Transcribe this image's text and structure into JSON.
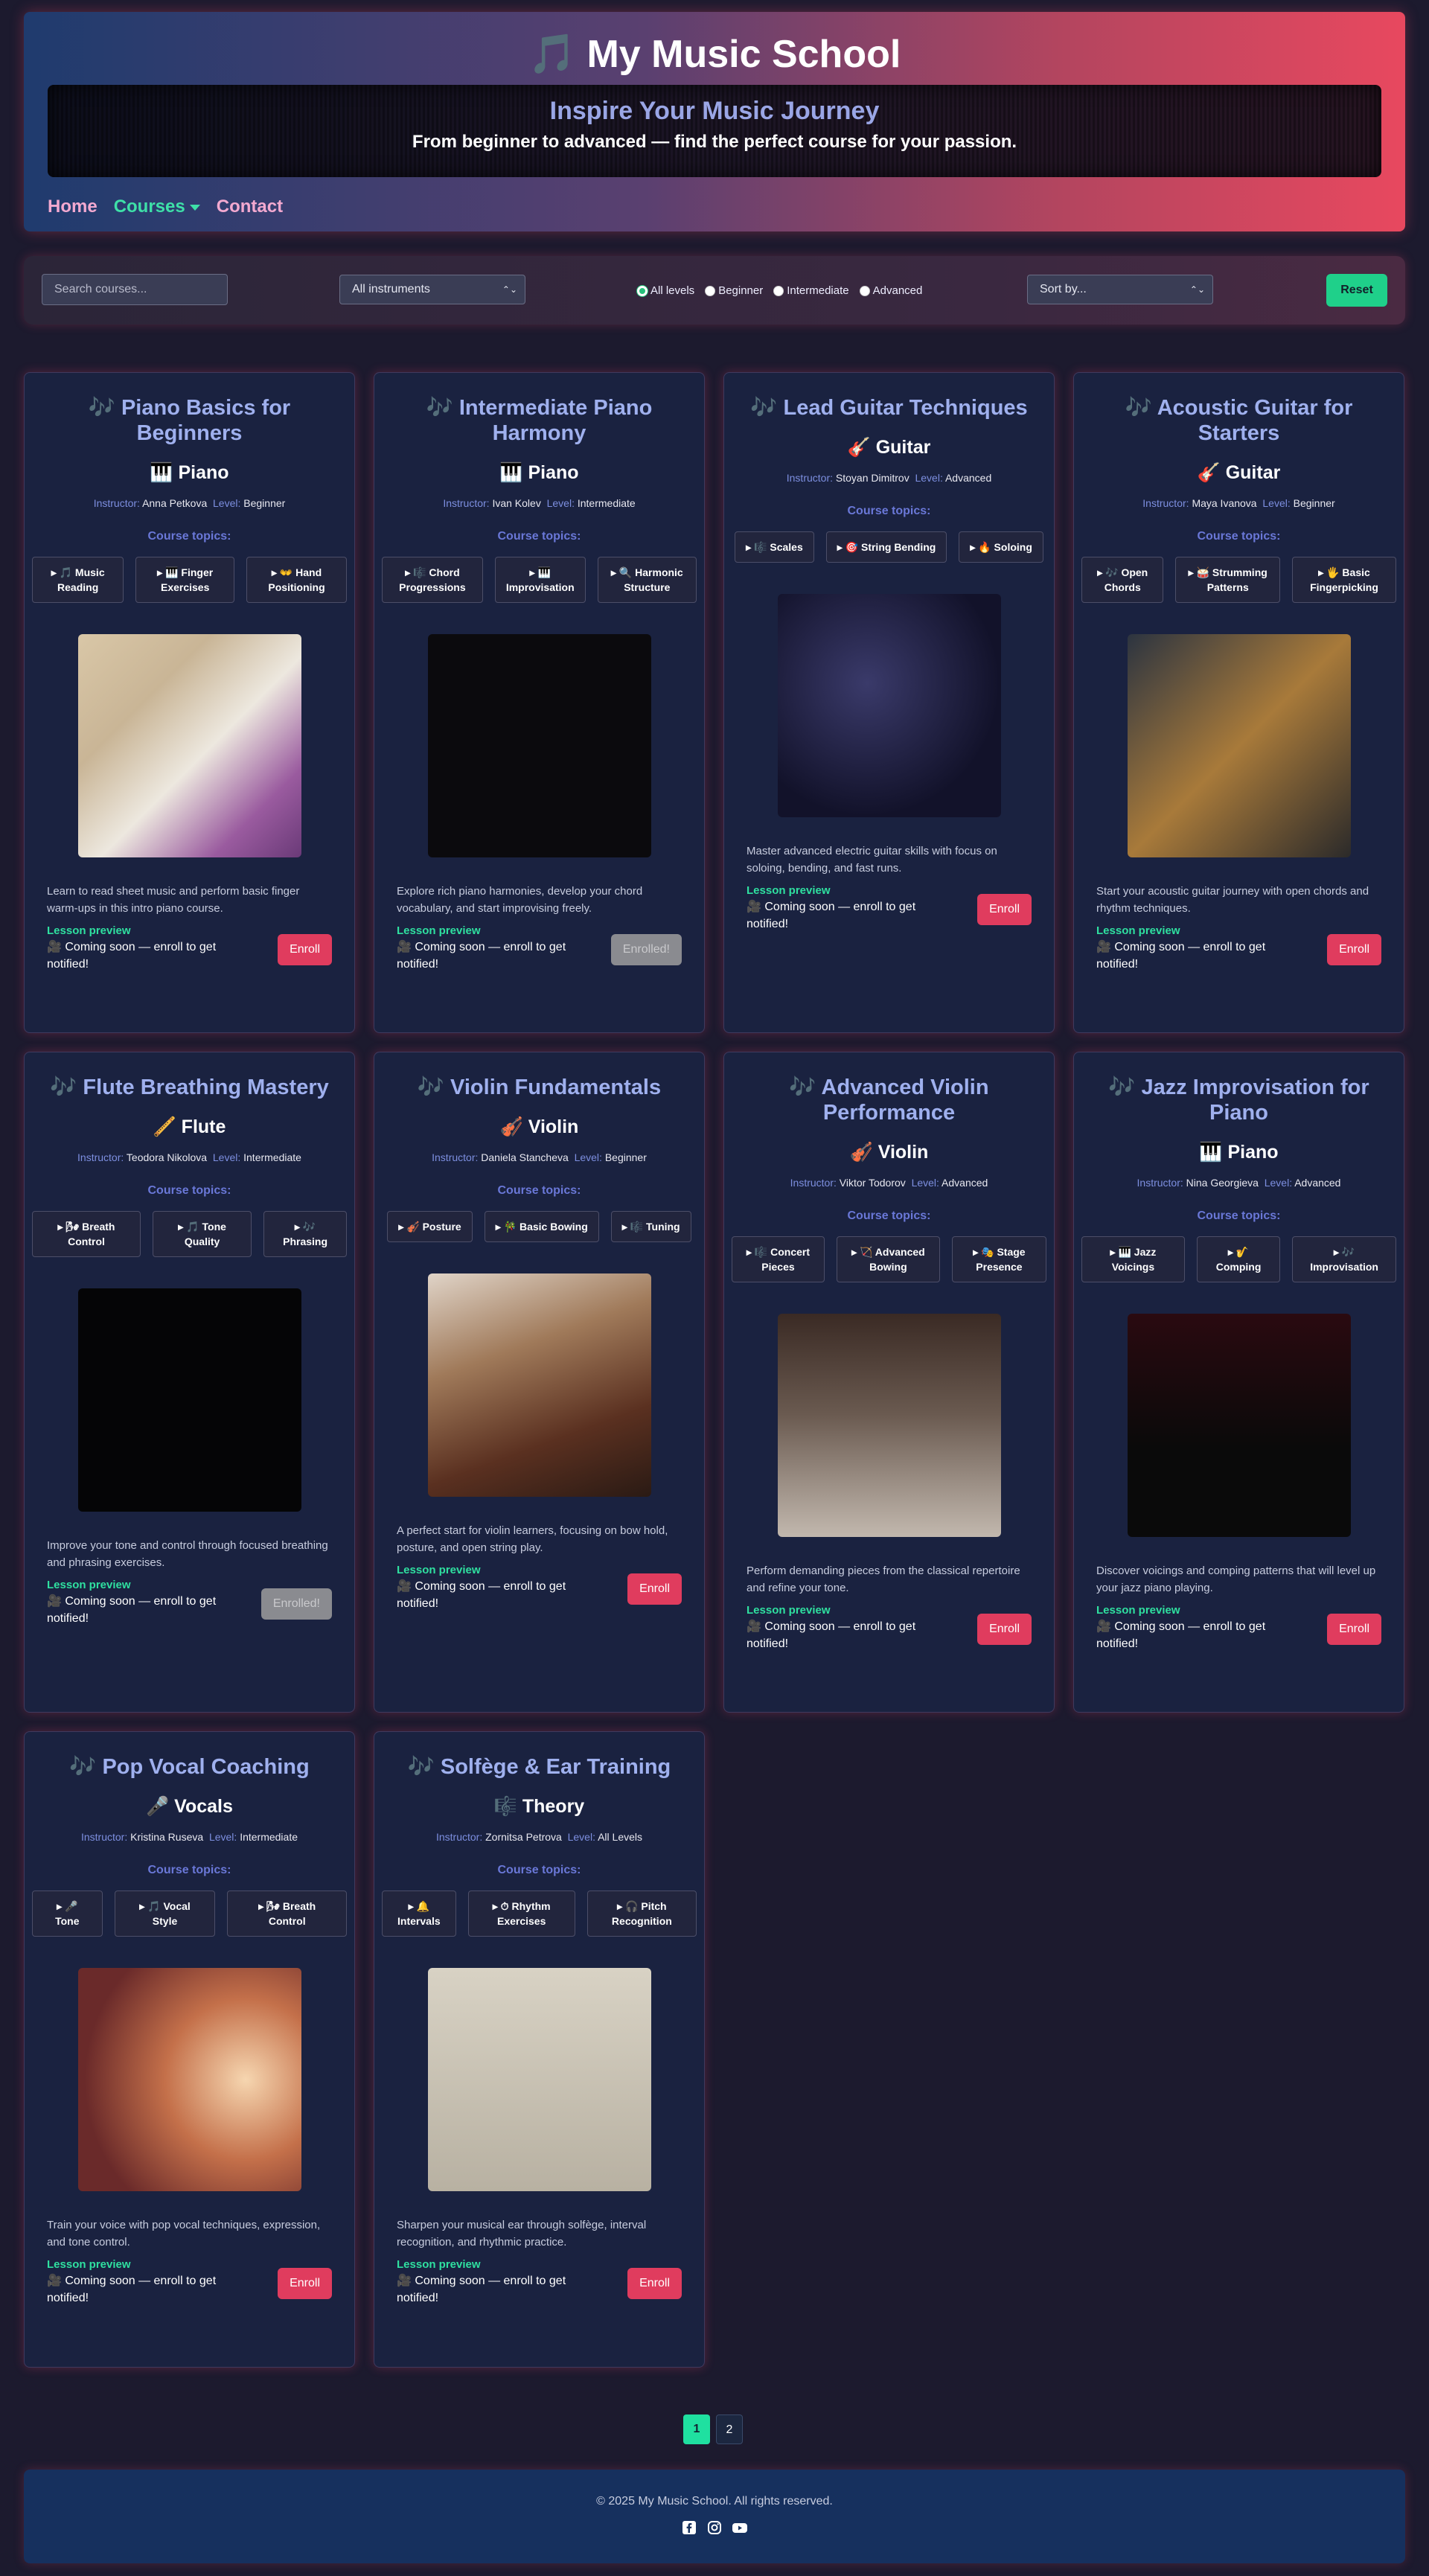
{
  "header": {
    "title": "My Music School",
    "title_icon": "music-note-icon",
    "hero_title": "Inspire Your Music Journey",
    "hero_subtitle": "From beginner to advanced — find the perfect course for your passion."
  },
  "nav": {
    "items": [
      {
        "label": "Home"
      },
      {
        "label": "Courses"
      },
      {
        "label": "Contact"
      }
    ]
  },
  "filters": {
    "search_placeholder": "Search courses...",
    "instrument_select": "All instruments",
    "levels": [
      "All levels",
      "Beginner",
      "Intermediate",
      "Advanced"
    ],
    "sort_select": "Sort by...",
    "reset_label": "Reset"
  },
  "labels": {
    "instructor": "Instructor:",
    "level": "Level:",
    "topics": "Course topics:",
    "preview": "Lesson preview",
    "coming_soon": "🎥 Coming soon — enroll to get notified!"
  },
  "courses": [
    {
      "title": "🎶 Piano Basics for Beginners",
      "instrument": "🎹 Piano",
      "instructor": "Anna Petkova",
      "level": "Beginner",
      "topics": [
        "▸ 🎵 Music Reading",
        "▸ 🎹 Finger Exercises",
        "▸ 👐 Hand Positioning"
      ],
      "description": "Learn to read sheet music and perform basic finger warm-ups in this intro piano course.",
      "button": "Enroll",
      "enrolled": false
    },
    {
      "title": "🎶 Intermediate Piano Harmony",
      "instrument": "🎹 Piano",
      "instructor": "Ivan Kolev",
      "level": "Intermediate",
      "topics": [
        "▸ 🎼 Chord Progressions",
        "▸ 🎹 Improvisation",
        "▸ 🔍 Harmonic Structure"
      ],
      "description": "Explore rich piano harmonies, develop your chord vocabulary, and start improvising freely.",
      "button": "Enrolled!",
      "enrolled": true
    },
    {
      "title": "🎶 Lead Guitar Techniques",
      "instrument": "🎸 Guitar",
      "instructor": "Stoyan Dimitrov",
      "level": "Advanced",
      "topics": [
        "▸ 🎼 Scales",
        "▸ 🎯 String Bending",
        "▸ 🔥 Soloing"
      ],
      "description": "Master advanced electric guitar skills with focus on soloing, bending, and fast runs.",
      "button": "Enroll",
      "enrolled": false
    },
    {
      "title": "🎶 Acoustic Guitar for Starters",
      "instrument": "🎸 Guitar",
      "instructor": "Maya Ivanova",
      "level": "Beginner",
      "topics": [
        "▸ 🎶 Open Chords",
        "▸ 🥁 Strumming Patterns",
        "▸ 🖐 Basic Fingerpicking"
      ],
      "description": "Start your acoustic guitar journey with open chords and rhythm techniques.",
      "button": "Enroll",
      "enrolled": false
    },
    {
      "title": "🎶 Flute Breathing Mastery",
      "instrument": "🪈 Flute",
      "instructor": "Teodora Nikolova",
      "level": "Intermediate",
      "topics": [
        "▸ 🌬 Breath Control",
        "▸ 🎵 Tone Quality",
        "▸ 🎶 Phrasing"
      ],
      "description": "Improve your tone and control through focused breathing and phrasing exercises.",
      "button": "Enrolled!",
      "enrolled": true
    },
    {
      "title": "🎶 Violin Fundamentals",
      "instrument": "🎻 Violin",
      "instructor": "Daniela Stancheva",
      "level": "Beginner",
      "topics": [
        "▸ 🎻 Posture",
        "▸ 🎋 Basic Bowing",
        "▸ 🎼 Tuning"
      ],
      "description": "A perfect start for violin learners, focusing on bow hold, posture, and open string play.",
      "button": "Enroll",
      "enrolled": false
    },
    {
      "title": "🎶 Advanced Violin Performance",
      "instrument": "🎻 Violin",
      "instructor": "Viktor Todorov",
      "level": "Advanced",
      "topics": [
        "▸ 🎼 Concert Pieces",
        "▸ 🏹 Advanced Bowing",
        "▸ 🎭 Stage Presence"
      ],
      "description": "Perform demanding pieces from the classical repertoire and refine your tone.",
      "button": "Enroll",
      "enrolled": false
    },
    {
      "title": "🎶 Jazz Improvisation for Piano",
      "instrument": "🎹 Piano",
      "instructor": "Nina Georgieva",
      "level": "Advanced",
      "topics": [
        "▸ 🎹 Jazz Voicings",
        "▸ 🎷 Comping",
        "▸ 🎶 Improvisation"
      ],
      "description": "Discover voicings and comping patterns that will level up your jazz piano playing.",
      "button": "Enroll",
      "enrolled": false
    },
    {
      "title": "🎶 Pop Vocal Coaching",
      "instrument": "🎤 Vocals",
      "instructor": "Kristina Ruseva",
      "level": "Intermediate",
      "topics": [
        "▸ 🎤 Tone",
        "▸ 🎵 Vocal Style",
        "▸ 🌬 Breath Control"
      ],
      "description": "Train your voice with pop vocal techniques, expression, and tone control.",
      "button": "Enroll",
      "enrolled": false
    },
    {
      "title": "🎶 Solfège & Ear Training",
      "instrument": "🎼 Theory",
      "instructor": "Zornitsa Petrova",
      "level": "All Levels",
      "topics": [
        "▸ 🔔 Intervals",
        "▸ ⏱ Rhythm Exercises",
        "▸ 🎧 Pitch Recognition"
      ],
      "description": "Sharpen your musical ear through solfège, interval recognition, and rhythmic practice.",
      "button": "Enroll",
      "enrolled": false
    }
  ],
  "pagination": {
    "pages": [
      "1",
      "2"
    ],
    "current": "1"
  },
  "footer": {
    "copyright": "© 2025 My Music School. All rights reserved.",
    "socials": [
      "facebook-icon",
      "instagram-icon",
      "youtube-icon"
    ]
  }
}
